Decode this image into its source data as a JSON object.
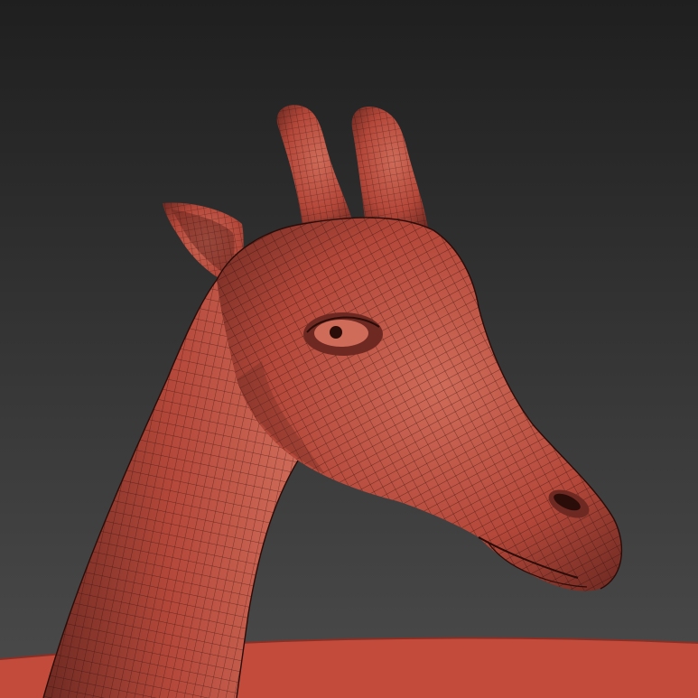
{
  "viewport": {
    "colors": {
      "background_top": "#1f1f1f",
      "background_bottom": "#4b4b4b",
      "model_base": "#b4483a",
      "model_light": "#cf6b59",
      "model_shadow": "#6e2a22",
      "wire": "#2a0c08",
      "ground": "#c24b3b",
      "ground_edge": "#8a2f25"
    },
    "model": {
      "subject": "giraffe-head",
      "display_mode": "wireframe-on-shaded"
    }
  }
}
